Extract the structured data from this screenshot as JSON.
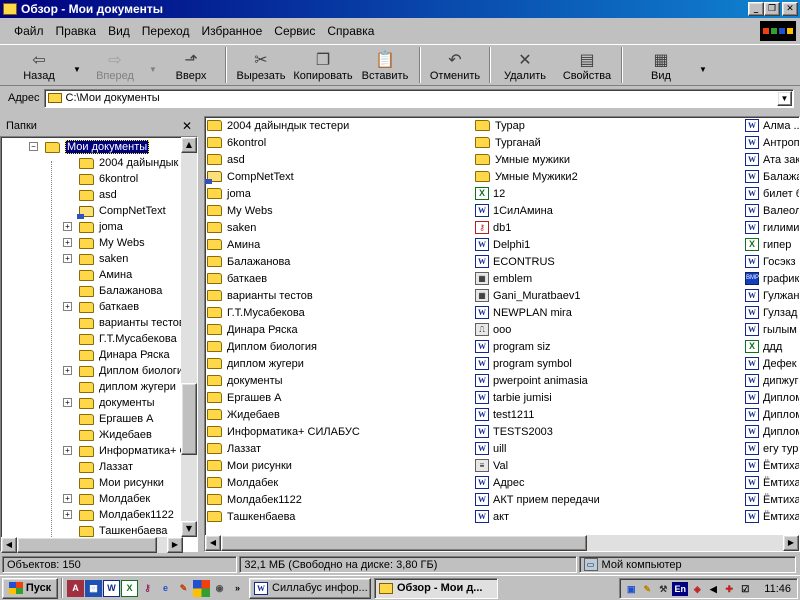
{
  "window": {
    "title": "Обзор - Мои документы"
  },
  "menu": [
    "Файл",
    "Правка",
    "Вид",
    "Переход",
    "Избранное",
    "Сервис",
    "Справка"
  ],
  "toolbar": {
    "back": "Назад",
    "forward": "Вперед",
    "up": "Вверх",
    "cut": "Вырезать",
    "copy": "Копировать",
    "paste": "Вставить",
    "undo": "Отменить",
    "delete": "Удалить",
    "properties": "Свойства",
    "view": "Вид"
  },
  "address": {
    "label": "Адрес",
    "value": "C:\\Мои документы"
  },
  "tree": {
    "header": "Папки",
    "selected": "Мои документы",
    "items": [
      "2004 дайындык",
      "6kontrol",
      "asd",
      "CompNetText",
      "joma",
      "My Webs",
      "saken",
      "Амина",
      "Балажанова",
      "баткаев",
      "варианты тестов",
      "Г.Т.Мусабекова",
      "Динара Ряска",
      "Диплом биологи",
      "диплом жугери",
      "документы",
      "Ергашев А",
      "Жидебаев",
      "Информатика+ С",
      "Лаззат",
      "Мои рисунки",
      "Молдабек",
      "Молдабек1122",
      "Ташкенбаева"
    ]
  },
  "files": {
    "col1": [
      "2004 дайындык тестери",
      "6kontrol",
      "asd",
      "CompNetText",
      "joma",
      "My Webs",
      "saken",
      "Амина",
      "Балажанова",
      "баткаев",
      "варианты тестов",
      "Г.Т.Мусабекова",
      "Динара Ряска",
      "Диплом биология",
      "диплом жугери",
      "документы",
      "Ергашев А",
      "Жидебаев",
      "Информатика+ СИЛАБУС",
      "Лаззат",
      "Мои рисунки",
      "Молдабек",
      "Молдабек1122",
      "Ташкенбаева"
    ],
    "col2": [
      "Турар",
      "Турганай",
      "Умные мужики",
      "Умные Мужики2",
      "12",
      "1СилАмина",
      "db1",
      "Delphi1",
      "ECONTRUS",
      "emblem",
      "Gani_Muratbaev1",
      "NEWPLAN mira",
      "ooo",
      "program siz",
      "program symbol",
      "pwerpoint animasia",
      "tarbie jumisi",
      "test1211",
      "TESTS2003",
      "uill",
      "Val",
      "Адрес",
      "АКТ прием передачи",
      "акт"
    ],
    "col3": [
      "Алма ..",
      "Антроп",
      "Ата зак",
      "Балажа",
      "билет б",
      "Валеол",
      "гилими",
      "гипер",
      "Госэкз",
      "графики",
      "Гулжан",
      "Гулзад",
      "гылым",
      "ддд",
      "Дефек",
      "дипжуг",
      "Диплом",
      "Диплом",
      "Диплом",
      "егу тур",
      "Ёмтиха",
      "Ёмтиха",
      "Ёмтиха",
      "Ёмтиха"
    ]
  },
  "status": {
    "objects": "Объектов: 150",
    "size": "32,1 МБ (Свободно на диске: 3,80 ГБ)",
    "location": "Мой компьютер"
  },
  "taskbar": {
    "start": "Пуск",
    "tasks": [
      "Силлабус инфор...",
      "Обзор - Мои д..."
    ],
    "lang": "En",
    "clock": "11:46"
  }
}
